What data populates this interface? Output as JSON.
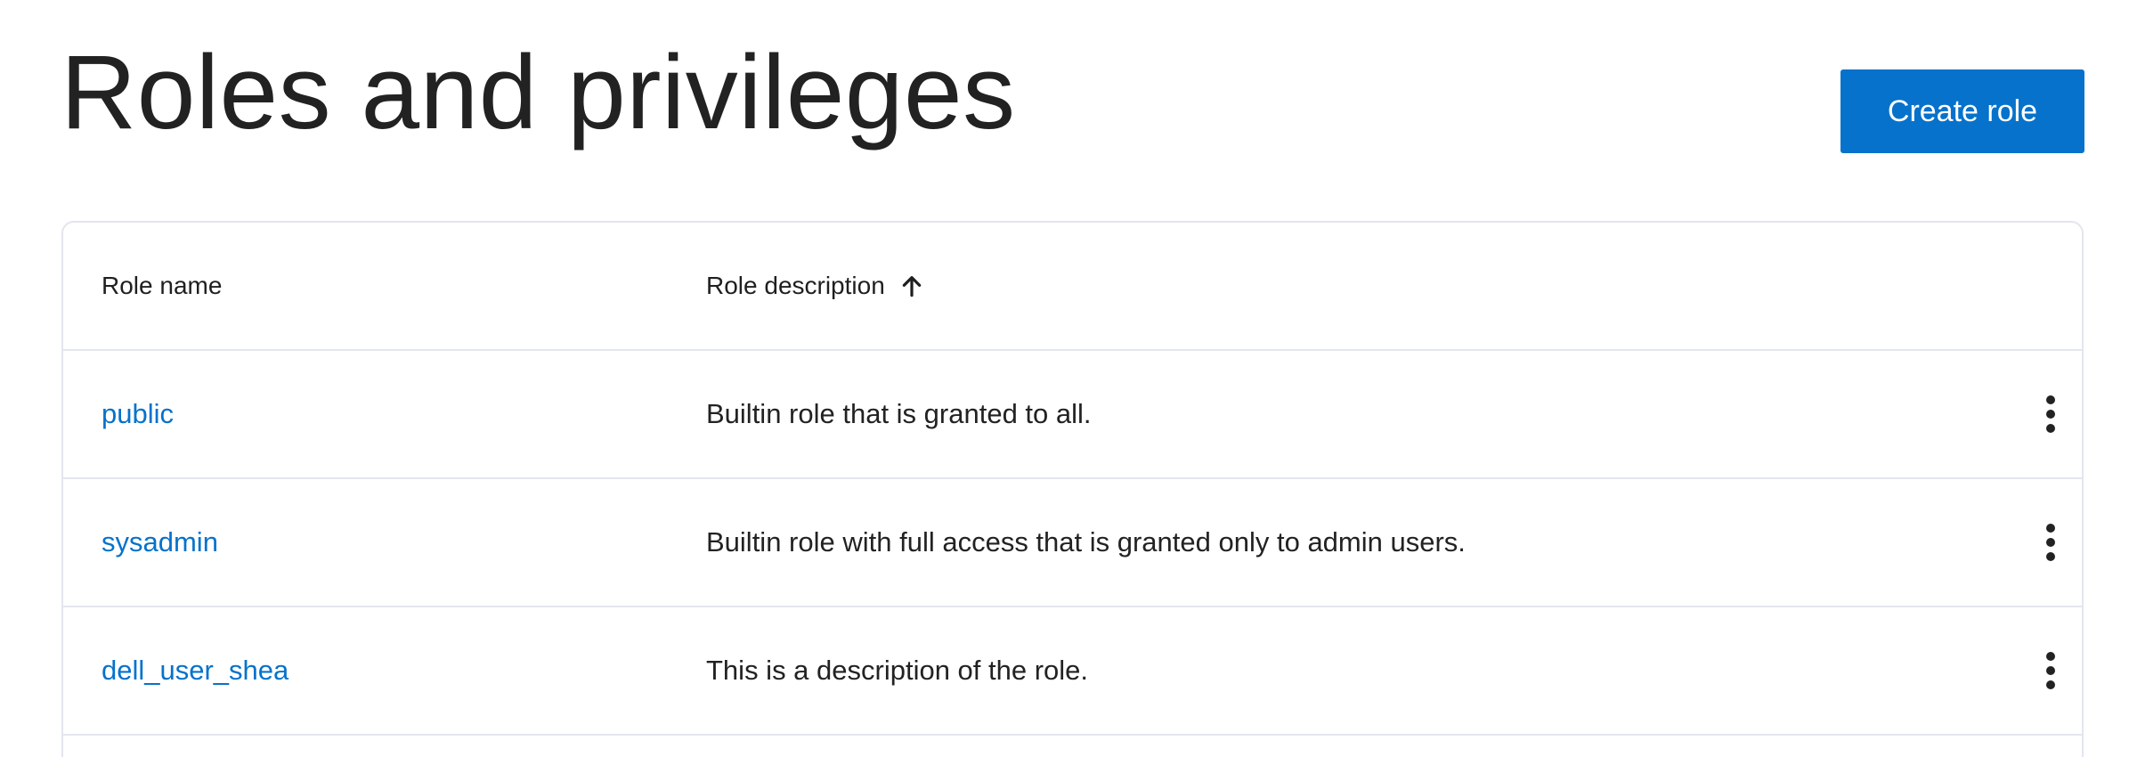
{
  "header": {
    "title": "Roles and privileges",
    "create_button_label": "Create role"
  },
  "table": {
    "columns": {
      "name": "Role name",
      "description": "Role description",
      "description_sort": "ascending",
      "sort_icon": "arrow-up-icon"
    },
    "rows": [
      {
        "name": "public",
        "description": "Builtin role that is granted to all.",
        "action_icon": "more-vertical-icon"
      },
      {
        "name": "sysadmin",
        "description": "Builtin role with full access that is granted only to admin users.",
        "action_icon": "more-vertical-icon"
      },
      {
        "name": "dell_user_shea",
        "description": "This is a description of the role.",
        "action_icon": "more-vertical-icon"
      }
    ]
  },
  "colors": {
    "accent": "#0672cb",
    "border": "#e4e6ee",
    "text": "#222222"
  }
}
